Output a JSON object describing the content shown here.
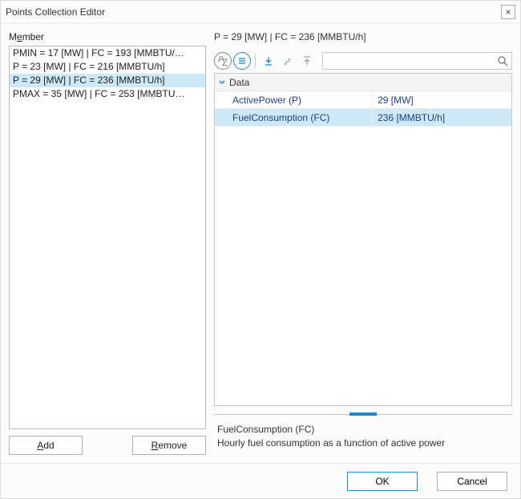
{
  "window": {
    "title": "Points Collection Editor",
    "close_glyph": "×"
  },
  "left": {
    "member_label_pre": "M",
    "member_label_ul": "e",
    "member_label_post": "mber",
    "items": [
      "PMIN = 17 [MW] | FC = 193 [MMBTU/…",
      "P = 23 [MW] | FC = 216 [MMBTU/h]",
      "P = 29 [MW] | FC = 236 [MMBTU/h]",
      "PMAX = 35 [MW] | FC = 253 [MMBTU…"
    ],
    "selected_index": 2,
    "add_pre": "",
    "add_ul": "A",
    "add_post": "dd",
    "remove_pre": "",
    "remove_ul": "R",
    "remove_post": "emove"
  },
  "right": {
    "summary": "P = 29 [MW] |  FC = 236 [MMBTU/h]",
    "search_placeholder": "",
    "category": "Data",
    "props": [
      {
        "name": "ActivePower (P)",
        "value": "29 [MW]",
        "highlight": false
      },
      {
        "name": "FuelConsumption (FC)",
        "value": "236 [MMBTU/h]",
        "highlight": true
      }
    ],
    "desc": {
      "name": "FuelConsumption (FC)",
      "text": "Hourly fuel consumption as a function of active power"
    }
  },
  "footer": {
    "ok": "OK",
    "cancel": "Cancel"
  }
}
